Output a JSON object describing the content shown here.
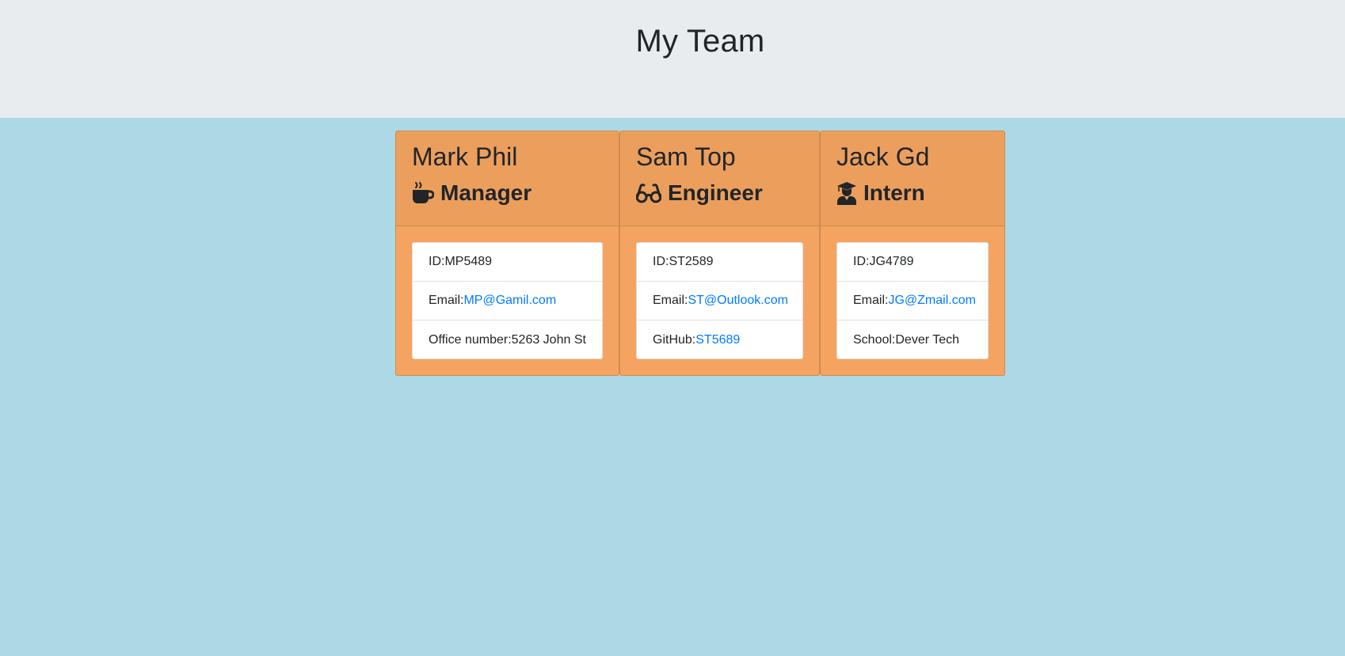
{
  "header": {
    "title": "My Team"
  },
  "employees": [
    {
      "name": "Mark Phil",
      "role": "Manager",
      "icon": "mug-icon",
      "id_label": "ID: ",
      "id": "MP5489",
      "email_label": "Email: ",
      "email": "MP@Gamil.com",
      "extra_label": "Office number: ",
      "extra_value": "5263 John St"
    },
    {
      "name": "Sam Top",
      "role": "Engineer",
      "icon": "glasses-icon",
      "id_label": "ID: ",
      "id": "ST2589",
      "email_label": "Email: ",
      "email": "ST@Outlook.com",
      "extra_label": "GitHub: ",
      "extra_value": "ST5689"
    },
    {
      "name": "Jack Gd",
      "role": "Intern",
      "icon": "graduate-icon",
      "id_label": "ID: ",
      "id": "JG4789",
      "email_label": "Email: ",
      "email": "JG@Zmail.com",
      "extra_label": "School: ",
      "extra_value": "Dever Tech"
    }
  ],
  "colors": {
    "page_background": "#add8e6",
    "header_background": "#e9ecef",
    "card_body": "#f4a460",
    "card_header": "#ec9f5c",
    "link": "#007bff"
  }
}
